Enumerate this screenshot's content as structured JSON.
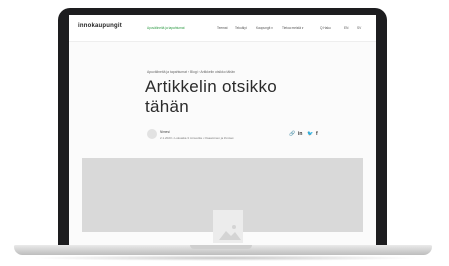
{
  "header": {
    "logo": "innokaupungit",
    "nav": [
      {
        "label": "Apuvälineitä ja tapahtumat",
        "active": true
      },
      {
        "label": "Teemat",
        "active": false
      },
      {
        "label": "Tekoälyt",
        "active": false
      },
      {
        "label": "Kaupungit ▾",
        "active": false
      },
      {
        "label": "Tietoa meistä ▾",
        "active": false
      },
      {
        "label": "Q Haku",
        "active": false
      },
      {
        "label": "EN",
        "active": false
      },
      {
        "label": "SV",
        "active": false
      }
    ]
  },
  "article": {
    "breadcrumb": "Apuvälineitä ja tapahtumat  ›  Blogi  ›  Artikkelin otsikko tähän",
    "title_line1": "Artikkelin otsikko",
    "title_line2": "tähän",
    "author": {
      "name": "Nimesi",
      "meta": "2.1.2023  •  Lukuaika 3 minuuttia  •  Osaaminen ja ihmiset"
    },
    "share_icons": [
      "link-icon",
      "linkedin-icon",
      "twitter-icon",
      "facebook-icon"
    ]
  },
  "colors": {
    "accent": "#2e9b45",
    "hero_placeholder": "#d9d9d9",
    "laptop_bezel": "#1d1d1f"
  }
}
